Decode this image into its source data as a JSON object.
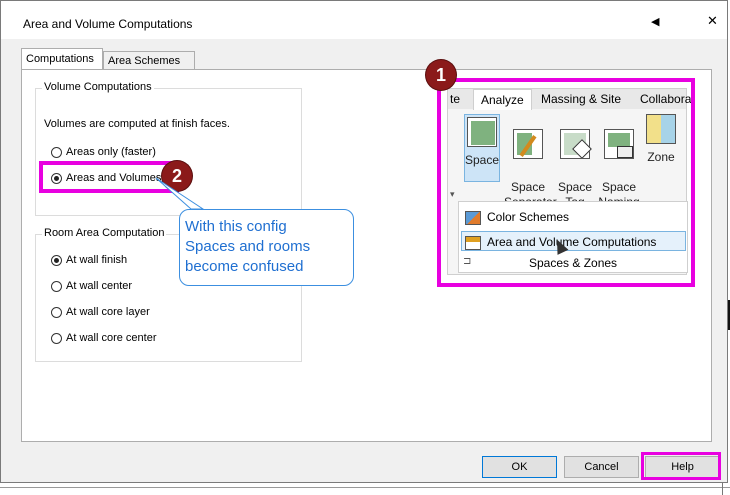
{
  "dialog": {
    "title": "Area and Volume Computations",
    "help_glyph": "◀",
    "close_glyph": "✕"
  },
  "tabs": [
    {
      "label": "Computations"
    },
    {
      "label": "Area Schemes"
    }
  ],
  "volume_group": {
    "title": "Volume Computations",
    "description": "Volumes are computed at finish faces.",
    "options": [
      {
        "label": "Areas only (faster)",
        "checked": false
      },
      {
        "label": "Areas and Volumes",
        "checked": true
      }
    ]
  },
  "room_area_group": {
    "title": "Room Area Computation",
    "options": [
      {
        "label": "At wall finish",
        "checked": true
      },
      {
        "label": "At wall center",
        "checked": false
      },
      {
        "label": "At wall core layer",
        "checked": false
      },
      {
        "label": "At wall core center",
        "checked": false
      }
    ]
  },
  "annotations": {
    "badge1": "1",
    "badge2": "2",
    "callout_lines": [
      "With this config",
      "Spaces and rooms",
      "become confused"
    ],
    "highlight_color": "#e800e0",
    "badge_color": "#8b1a1a",
    "callout_color": "#1f6fd1"
  },
  "ribbon": {
    "tabs": [
      "te",
      "Analyze",
      "Massing & Site",
      "Collabora"
    ],
    "buttons": [
      {
        "label": "Space",
        "icon": "space-icon"
      },
      {
        "label": "Space\nSeparator",
        "icon": "space-separator-icon"
      },
      {
        "label": "Space\nTag",
        "icon": "space-tag-icon"
      },
      {
        "label": "Space\nNaming",
        "icon": "space-naming-icon"
      },
      {
        "label": "Zone",
        "icon": "zone-icon"
      }
    ],
    "menu_items": [
      {
        "label": "Color Schemes",
        "icon": "color-schemes-icon"
      },
      {
        "label": "Area and Volume Computations",
        "icon": "area-volume-icon"
      }
    ],
    "panel_label": "Spaces & Zones"
  },
  "buttons": {
    "ok": "OK",
    "cancel": "Cancel",
    "help": "Help"
  }
}
